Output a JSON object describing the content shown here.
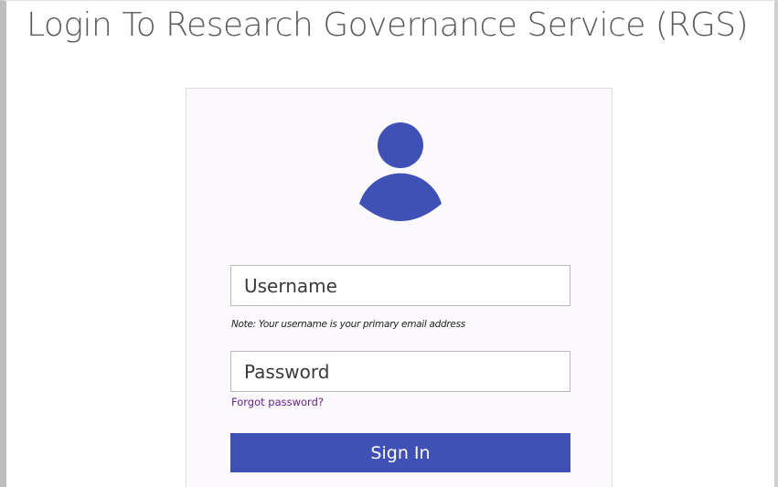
{
  "page": {
    "title": "Login To Research Governance Service (RGS)"
  },
  "login": {
    "avatar_icon": "user-avatar-icon",
    "username_placeholder": "Username",
    "username_value": "",
    "username_note": "Note: Your username is your primary email address",
    "password_placeholder": "Password",
    "password_value": "",
    "forgot_password_label": "Forgot password?",
    "sign_in_label": "Sign In"
  },
  "colors": {
    "accent": "#3f51b5",
    "link": "#6a1f8e",
    "card_background": "#fcf9fd"
  }
}
